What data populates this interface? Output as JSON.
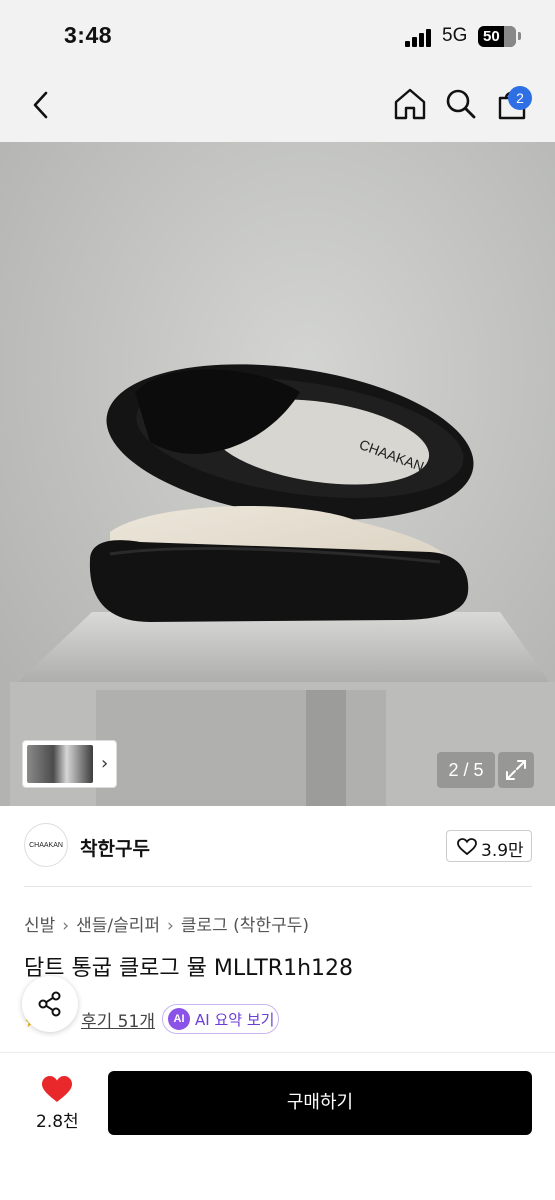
{
  "status_bar": {
    "time": "3:48",
    "network": "5G",
    "battery": "50"
  },
  "nav": {
    "cart_count": "2"
  },
  "gallery": {
    "pager": "2 / 5",
    "product_print": "CHAAKAN"
  },
  "brand": {
    "logo_text": "CHAAKAN",
    "name": "착한구두",
    "likes": "3.9만"
  },
  "breadcrumb": [
    "신발",
    "샌들/슬리퍼",
    "클로그 (착한구두)"
  ],
  "product": {
    "title": "담트 통굽 클로그 뮬 MLLTR1h128",
    "reviews": "후기 51개",
    "ai_badge": "AI",
    "ai_summary": "AI 요약 보기"
  },
  "bottom": {
    "like_count": "2.8천",
    "buy_label": "구매하기"
  },
  "colors": {
    "cart_badge": "#2f6fe4",
    "ai_purple": "#8b52e8",
    "heart_red": "#e8282b",
    "buy_button": "#000000"
  }
}
